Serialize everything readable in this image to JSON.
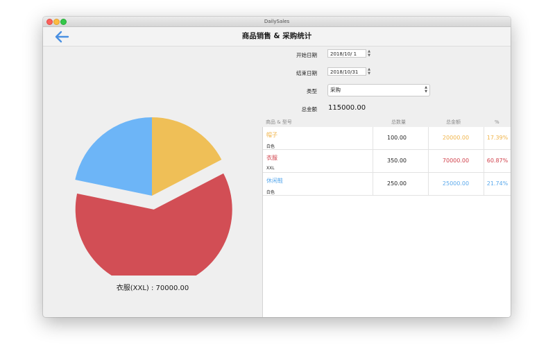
{
  "window": {
    "title": "DailySales"
  },
  "nav": {
    "title": "商品销售 & 采购统计",
    "back_icon": "arrow-left-icon"
  },
  "form": {
    "start_label": "开始日期",
    "start_value": "2018/10/ 1",
    "end_label": "结束日期",
    "end_value": "2018/10/31",
    "type_label": "类型",
    "type_value": "采购",
    "total_label": "总金额",
    "total_value": "115000.00"
  },
  "table": {
    "headers": [
      "商品 & 型号",
      "总数量",
      "总金额",
      "%"
    ],
    "rows": [
      {
        "name": "帽子",
        "model": "白色",
        "qty": "100.00",
        "amount": "20000.00",
        "pct": "17.39%",
        "color": "#f0b44a"
      },
      {
        "name": "衣服",
        "model": "XXL",
        "qty": "350.00",
        "amount": "70000.00",
        "pct": "60.87%",
        "color": "#d0404a"
      },
      {
        "name": "休闲鞋",
        "model": "白色",
        "qty": "250.00",
        "amount": "25000.00",
        "pct": "21.74%",
        "color": "#5aa9ec"
      }
    ]
  },
  "chart_data": {
    "type": "pie",
    "slices": [
      {
        "label": "帽子(白色)",
        "value": 20000,
        "color": "#efbf57"
      },
      {
        "label": "衣服(XXL)",
        "value": 70000,
        "color": "#d24e55",
        "exploded": true
      },
      {
        "label": "休闲鞋(白色)",
        "value": 25000,
        "color": "#6db5f7"
      }
    ],
    "selection_label": "衣服(XXL) : 70000.00"
  }
}
